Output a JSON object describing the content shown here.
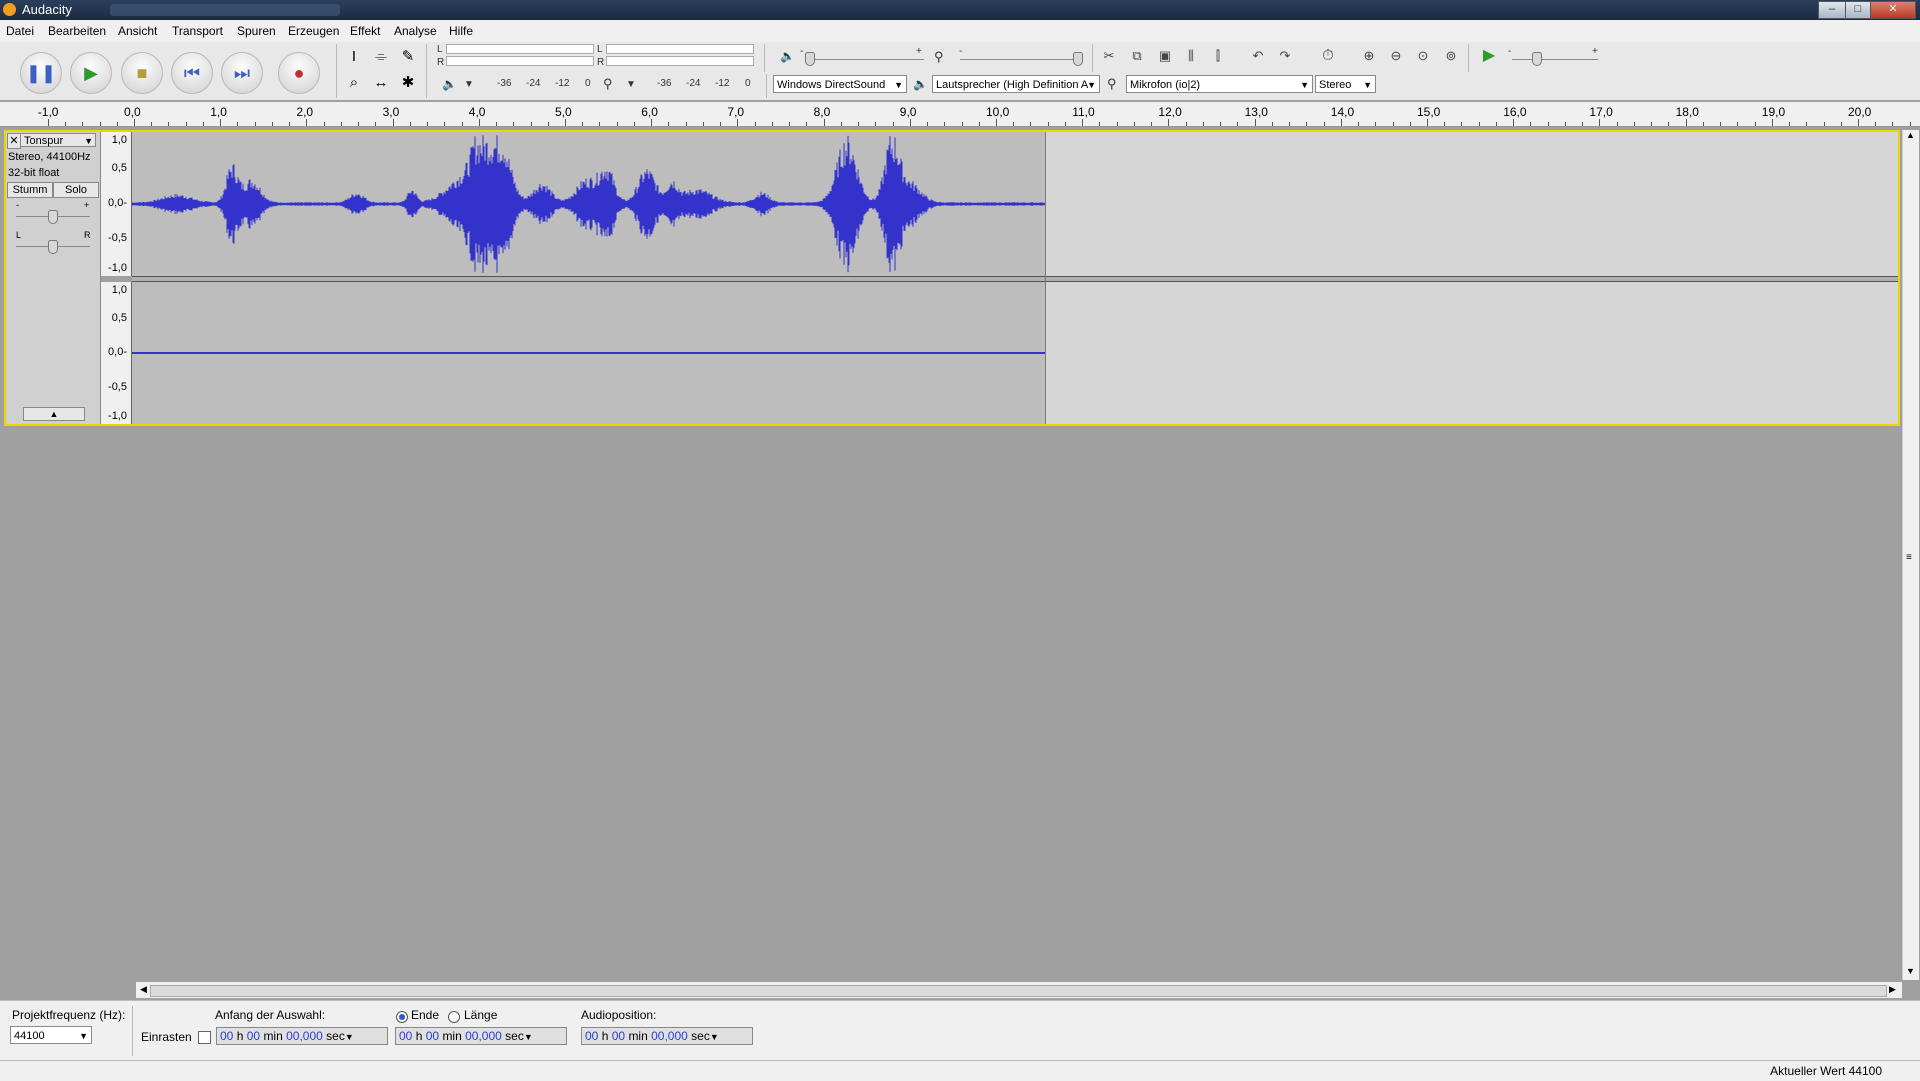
{
  "window": {
    "title": "Audacity",
    "minimize_glyph": "–",
    "maximize_glyph": "□",
    "close_glyph": "✕"
  },
  "menu": [
    "Datei",
    "Bearbeiten",
    "Ansicht",
    "Transport",
    "Spuren",
    "Erzeugen",
    "Effekt",
    "Analyse",
    "Hilfe"
  ],
  "transport": [
    {
      "name": "pause-button",
      "icon": "pause-icon",
      "glyph": "❚❚",
      "color": "#3b5fc4"
    },
    {
      "name": "play-button",
      "icon": "play-icon",
      "glyph": "▶",
      "color": "#2f9a2f"
    },
    {
      "name": "stop-button",
      "icon": "stop-icon",
      "glyph": "■",
      "color": "#b89a3a"
    },
    {
      "name": "skip-start-button",
      "icon": "skip-start-icon",
      "glyph": "⏮",
      "color": "#3b5fc4"
    },
    {
      "name": "skip-end-button",
      "icon": "skip-end-icon",
      "glyph": "⏭",
      "color": "#3b5fc4"
    },
    {
      "name": "record-button",
      "icon": "record-icon",
      "glyph": "●",
      "color": "#c03030"
    }
  ],
  "meters": {
    "playback": {
      "left_label": "L",
      "right_label": "R",
      "ticks": [
        "-36",
        "-24",
        "-12",
        "0"
      ]
    },
    "record": {
      "left_label": "L",
      "right_label": "R",
      "ticks": [
        "-36",
        "-24",
        "-12",
        "0"
      ]
    }
  },
  "mixer": {
    "minus": "-",
    "plus": "+"
  },
  "devices": {
    "host": "Windows DirectSound",
    "output": "Lautsprecher (High Definition A",
    "input": "Mikrofon (io|2)",
    "channels": "Stereo"
  },
  "ruler": {
    "labels": [
      "-1,0",
      "0,0",
      "1,0",
      "2,0",
      "3,0",
      "4,0",
      "5,0",
      "6,0",
      "7,0",
      "8,0",
      "9,0",
      "10,0",
      "11,0",
      "12,0",
      "13,0",
      "14,0",
      "15,0",
      "16,0",
      "17,0",
      "18,0",
      "19,0",
      "20,0"
    ]
  },
  "track": {
    "name": "Tonspur",
    "close_glyph": "✕",
    "format": "Stereo, 44100Hz",
    "sample_format": "32-bit float",
    "mute_label": "Stumm",
    "solo_label": "Solo",
    "gain_minus": "-",
    "gain_plus": "+",
    "pan_left": "L",
    "pan_right": "R",
    "axis_labels": [
      "1,0",
      "0,5",
      "0,0-",
      "-0,5",
      "-1,0"
    ],
    "wave_color": "#3333cc"
  },
  "selection": {
    "rate_label": "Projektfrequenz (Hz):",
    "rate_value": "44100",
    "snap_label": "Einrasten",
    "start_label": "Anfang der Auswahl:",
    "end_label": "Ende",
    "length_label": "Länge",
    "position_label": "Audioposition:",
    "time_hh": "00",
    "time_mm": "00",
    "time_ss": "00,000",
    "unit_h": "h",
    "unit_min": "min",
    "unit_sec": "sec"
  },
  "status": {
    "text": "Aktueller Wert 44100"
  }
}
